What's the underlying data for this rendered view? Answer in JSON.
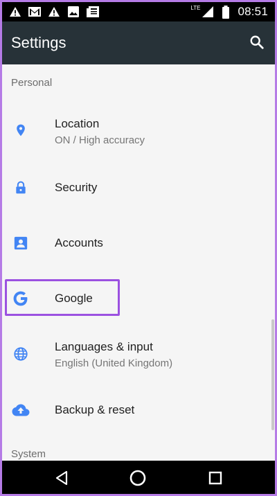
{
  "status_bar": {
    "time": "08:51",
    "network": "LTE",
    "icons": [
      "warning-icon",
      "gmail-icon",
      "warning-icon",
      "image-icon",
      "news-icon",
      "signal-icon",
      "battery-icon"
    ]
  },
  "app_bar": {
    "title": "Settings",
    "search_icon": "search-icon"
  },
  "sections": {
    "personal": "Personal",
    "system": "System"
  },
  "items": [
    {
      "title": "Location",
      "subtitle": "ON / High accuracy",
      "icon": "location-pin-icon"
    },
    {
      "title": "Security",
      "subtitle": "",
      "icon": "lock-icon"
    },
    {
      "title": "Accounts",
      "subtitle": "",
      "icon": "account-icon"
    },
    {
      "title": "Google",
      "subtitle": "",
      "icon": "google-icon"
    },
    {
      "title": "Languages & input",
      "subtitle": "English (United Kingdom)",
      "icon": "globe-icon"
    },
    {
      "title": "Backup & reset",
      "subtitle": "",
      "icon": "cloud-upload-icon"
    }
  ],
  "nav_bar": {
    "icons": [
      "back-icon",
      "home-icon",
      "recents-icon"
    ]
  },
  "colors": {
    "accent": "#4285f4",
    "app_bar": "#273238",
    "highlight": "#9b51e0"
  }
}
